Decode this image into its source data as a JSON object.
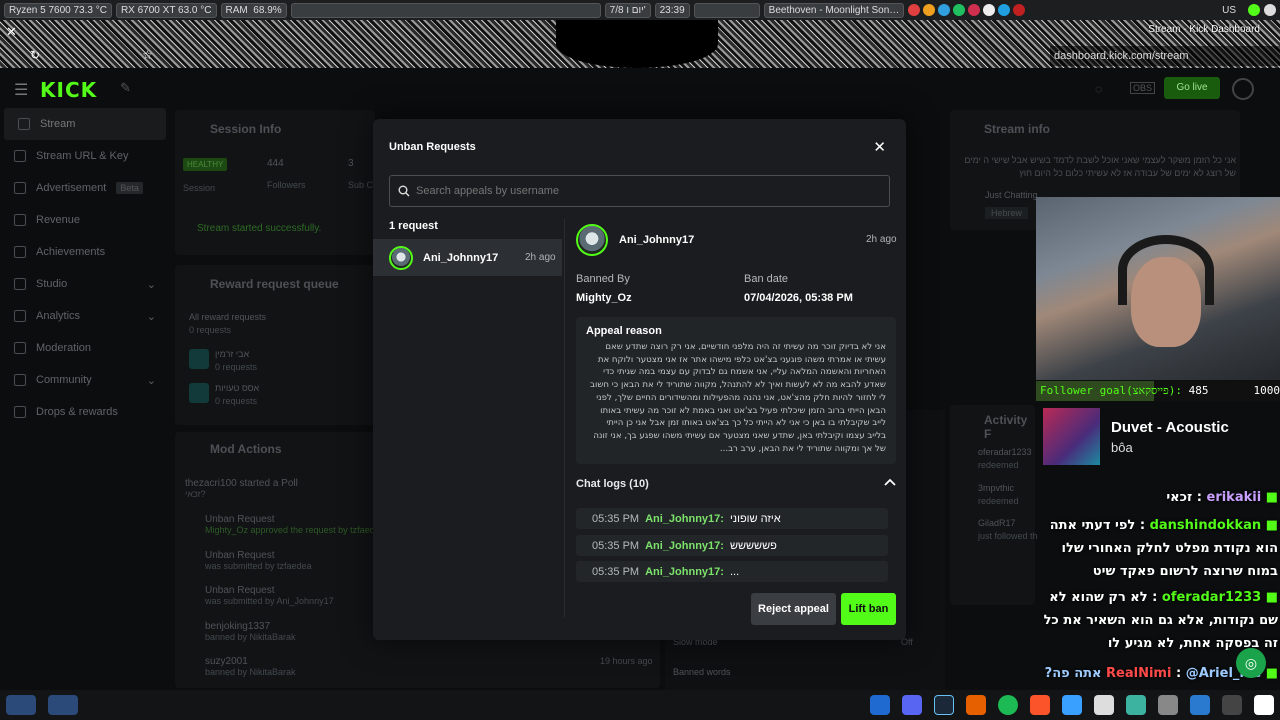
{
  "sysbar": {
    "cpu": "Ryzen 5 7600  73.3 °C",
    "gpu": "RX 6700 XT  63.0 °C",
    "ram_label": "RAM",
    "ram_value": "68.9%",
    "date": "7/8 יום ו'",
    "time": "23:39",
    "media": "Beethoven - Moonlight Son…",
    "lang": "US"
  },
  "browser": {
    "window_title": "Stream - Kick Dashboard",
    "url": "dashboard.kick.com/stream"
  },
  "header": {
    "logo": "KICK",
    "go_live": "Go live"
  },
  "sidebar": {
    "items": [
      {
        "label": "Stream"
      },
      {
        "label": "Stream URL & Key"
      },
      {
        "label": "Advertisement",
        "badge": "Beta"
      },
      {
        "label": "Revenue"
      },
      {
        "label": "Achievements"
      },
      {
        "label": "Studio"
      },
      {
        "label": "Analytics"
      },
      {
        "label": "Moderation"
      },
      {
        "label": "Community"
      },
      {
        "label": "Drops & rewards"
      }
    ]
  },
  "session": {
    "title": "Session Info",
    "health": "HEALTHY",
    "session_label": "Session",
    "followers_value": "444",
    "followers_label": "Followers",
    "subs_value": "3",
    "subs_label": "Sub C",
    "started": "Stream started successfully."
  },
  "rewards": {
    "title": "Reward request queue",
    "all_label": "All reward requests",
    "all_count": "0 requests",
    "items": [
      {
        "name": "אבי זרמין",
        "count": "0 requests"
      },
      {
        "name": "אסס טעויות",
        "count": "0 requests"
      }
    ]
  },
  "modactions": {
    "title": "Mod Actions",
    "items": [
      {
        "title": "thezacri100 started a Poll",
        "sub": "זכאי?"
      },
      {
        "title": "Unban Request",
        "sub": "Mighty_Oz approved the request by tzfaedea"
      },
      {
        "title": "Unban Request",
        "sub": "was submitted by tzfaedea"
      },
      {
        "title": "Unban Request",
        "sub": "was submitted by Ani_Johnny17"
      },
      {
        "title": "benjoking1337",
        "sub": "banned by NikitaBarak"
      },
      {
        "title": "suzy2001",
        "sub": "banned by NikitaBarak",
        "time": "19 hours ago"
      }
    ]
  },
  "streaminfo": {
    "title": "Stream info",
    "desc": "אני כל הזמן משקר לעצמי שאני אוכל לשבת לדמד בשיש אבל שישי ה ימים של רוצג לא ימים של עבודה אז לא עשיתי כלום כל היום חוץ",
    "category": "Just Chatting",
    "language": "Hebrew"
  },
  "activity": {
    "title": "Activity F",
    "items": [
      {
        "name": "oferadar1233",
        "sub": "redeemed"
      },
      {
        "name": "3mpvthic",
        "sub": "redeemed"
      },
      {
        "name": "GiladR17",
        "sub": "just followed the channel"
      }
    ]
  },
  "settings_rows": [
    {
      "label": "Slow mode",
      "value": "Off"
    },
    {
      "label": "Banned words",
      "value": ""
    }
  ],
  "modal": {
    "title": "Unban Requests",
    "search_placeholder": "Search appeals by username",
    "request_count": "1 request",
    "list": [
      {
        "username": "Ani_Johnny17",
        "ago": "2h ago"
      }
    ],
    "detail": {
      "username": "Ani_Johnny17",
      "ago": "2h ago",
      "banned_by_label": "Banned By",
      "banned_by": "Mighty_Oz",
      "ban_date_label": "Ban date",
      "ban_date": "07/04/2026, 05:38 PM",
      "appeal_label": "Appeal reason",
      "appeal_text": "אני לא בדיוק זוכר מה עשיתי זה היה מלפני חודשיים, אני רק רוצה שתדע שאם עשיתי או אמרתי משהו פוגעני בצ'אט כלפי מישהו אתר אז אני מצטער ולוקח את האחריות והאשמה המלאה עליי, אני אשמח גם לבדוק עם עצמי במה שגיתי כדי שאדע להבא מה לא לעשות ואיך לא להתנהל, מקווה שתוריד לי את הבאן כי חשוב לי לחזור להיות חלק מהצ'אט, אני נהנה מהפעילות ומהשידורים החיים שלך, לפני הבאן הייתי ברוב הזמן שיכלתי פעיל בצ'אט ואני באמת לא זוכר מה עשיתי באותו לייב שקיבלתי בו באן כי אני לא הייתי כל כך בצ'אט באותו זמן אבל אני כן הייתי בלייב עצמו וקיבלתי באן, שתדע שאני מצטער אם עשיתי משהו שפגע בך, אני זונה של אך ומקווה שתוריד לי את הבאן, ערב רב...",
      "chatlogs_label": "Chat logs (10)",
      "chatlogs": [
        {
          "time": "05:35 PM",
          "user": "Ani_Johnny17:",
          "msg": "איזה שופוני"
        },
        {
          "time": "05:35 PM",
          "user": "Ani_Johnny17:",
          "msg": "פששששש"
        },
        {
          "time": "05:35 PM",
          "user": "Ani_Johnny17:",
          "msg": "..."
        }
      ]
    },
    "reject_label": "Reject appeal",
    "lift_label": "Lift ban"
  },
  "overlay": {
    "goal_label": "Follower goal(פייסקאצ):",
    "goal_current": "485",
    "goal_target": "1000",
    "goal_progress": 0.485,
    "song_title": "Duvet - Acoustic",
    "song_artist": "bôa"
  },
  "chat": [
    {
      "user": "erikakii",
      "msg": "זכאי"
    },
    {
      "user": "danshindokkan",
      "msg": "לפי דעתי אתה הוא נקודת מפלט לחלק האחורי שלו במוח שרוצה לרשום פאקד שיט"
    },
    {
      "user": "oferadar1233",
      "msg": "לא רק שהוא לא שם נקודות, אלא גם הוא השאיר את כל זה בפסקה אחת, לא מגיע לו"
    },
    {
      "user": "RealNimi",
      "msg": "@Ariel_Me אתה פה?"
    }
  ],
  "colors": {
    "accent": "#53fc18",
    "modal_bg": "#1a1c1f",
    "page_bg": "#0b0d0e",
    "reject_bg": "#3a3d41"
  }
}
